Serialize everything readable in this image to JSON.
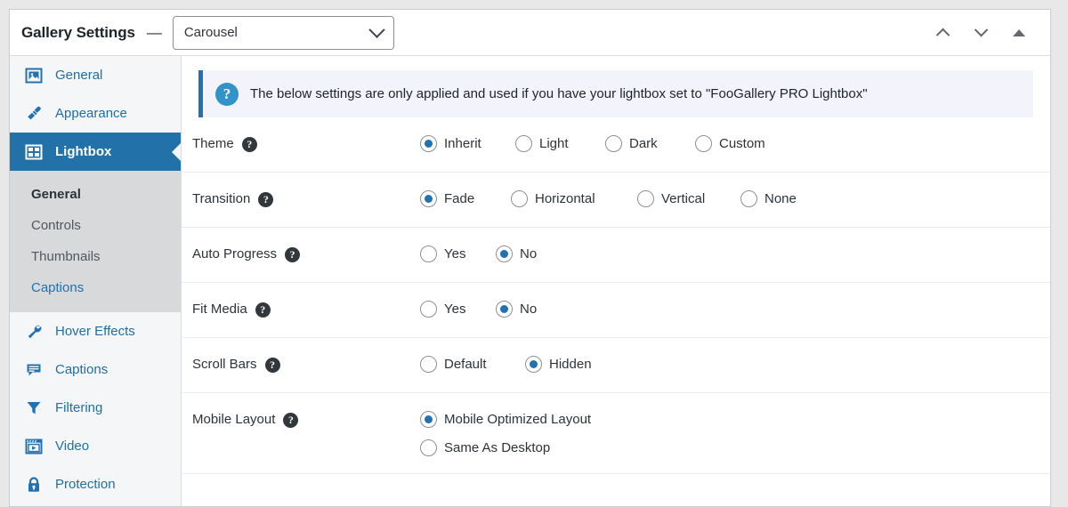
{
  "header": {
    "title": "Gallery Settings",
    "separator": "—",
    "gallery_select": {
      "value": "Carousel",
      "icon": "chevron-down-icon"
    },
    "actions": [
      {
        "name": "move-up-button",
        "icon": "chevron-up-icon"
      },
      {
        "name": "move-down-button",
        "icon": "chevron-down-icon"
      },
      {
        "name": "collapse-panel-button",
        "icon": "triangle-up-icon"
      }
    ]
  },
  "sidebar": {
    "items": [
      {
        "label": "General",
        "icon": "image-icon",
        "active": false
      },
      {
        "label": "Appearance",
        "icon": "paintbrush-icon",
        "active": false
      },
      {
        "label": "Lightbox",
        "icon": "grid-icon",
        "active": true
      },
      {
        "label": "Hover Effects",
        "icon": "wrench-icon",
        "active": false
      },
      {
        "label": "Captions",
        "icon": "comment-icon",
        "active": false
      },
      {
        "label": "Filtering",
        "icon": "funnel-icon",
        "active": false
      },
      {
        "label": "Video",
        "icon": "video-icon",
        "active": false
      },
      {
        "label": "Protection",
        "icon": "lock-icon",
        "active": false
      }
    ],
    "submenu": [
      {
        "label": "General",
        "state": "current"
      },
      {
        "label": "Controls",
        "state": "normal"
      },
      {
        "label": "Thumbnails",
        "state": "normal"
      },
      {
        "label": "Captions",
        "state": "link"
      }
    ]
  },
  "notice": {
    "icon": "question-mark-icon",
    "text": "The below settings are only applied and used if you have your lightbox set to \"FooGallery PRO Lightbox\""
  },
  "settings": {
    "rows": [
      {
        "label": "Theme",
        "help": "?",
        "layout": "inline",
        "options": [
          {
            "label": "Inherit",
            "selected": true
          },
          {
            "label": "Light",
            "selected": false
          },
          {
            "label": "Dark",
            "selected": false
          },
          {
            "label": "Custom",
            "selected": false
          }
        ]
      },
      {
        "label": "Transition",
        "help": "?",
        "layout": "inline",
        "options": [
          {
            "label": "Fade",
            "selected": true
          },
          {
            "label": "Horizontal",
            "selected": false
          },
          {
            "label": "Vertical",
            "selected": false
          },
          {
            "label": "None",
            "selected": false
          }
        ]
      },
      {
        "label": "Auto Progress",
        "help": "?",
        "layout": "inline",
        "options": [
          {
            "label": "Yes",
            "selected": false
          },
          {
            "label": "No",
            "selected": true
          }
        ]
      },
      {
        "label": "Fit Media",
        "help": "?",
        "layout": "inline",
        "options": [
          {
            "label": "Yes",
            "selected": false
          },
          {
            "label": "No",
            "selected": true
          }
        ]
      },
      {
        "label": "Scroll Bars",
        "help": "?",
        "layout": "inline",
        "options": [
          {
            "label": "Default",
            "selected": false
          },
          {
            "label": "Hidden",
            "selected": true
          }
        ]
      },
      {
        "label": "Mobile Layout",
        "help": "?",
        "layout": "stacked",
        "options": [
          {
            "label": "Mobile Optimized Layout",
            "selected": true
          },
          {
            "label": "Same As Desktop",
            "selected": false
          }
        ]
      }
    ]
  },
  "colors": {
    "accent": "#2271b1",
    "active_nav": "#2271a8",
    "notice_bg": "#f3f4fb",
    "sidebar_bg": "#f5f6f7",
    "submenu_bg": "#d8d9da"
  }
}
